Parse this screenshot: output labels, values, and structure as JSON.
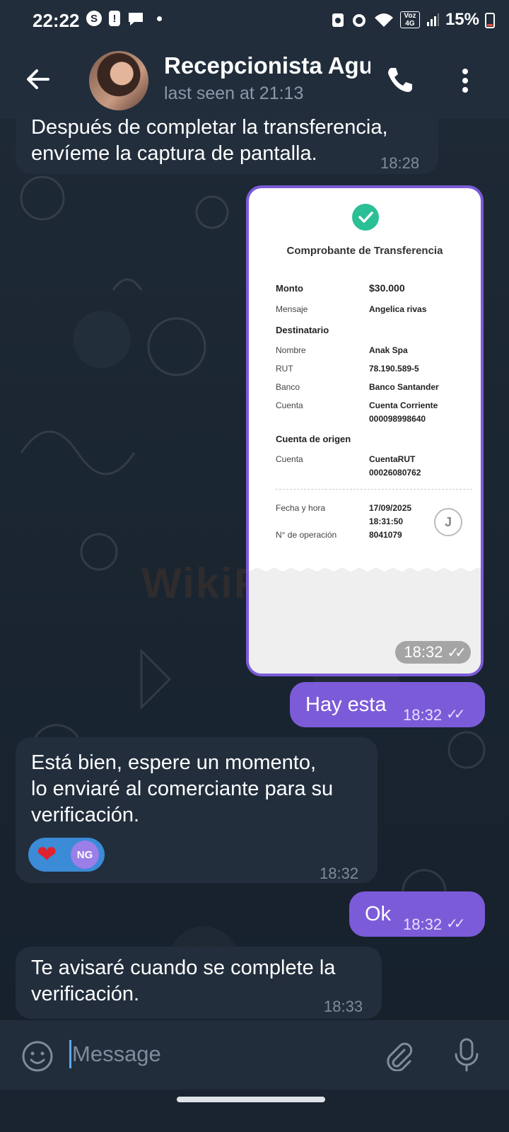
{
  "status_bar": {
    "time": "22:22",
    "signal_label": "Voz 4G",
    "battery": "15%",
    "icons": [
      "s-icon",
      "alert-icon",
      "chat-bubble-icon",
      "dot-icon",
      "recycle-icon",
      "alarm-icon",
      "wifi-icon",
      "signal-icon",
      "battery-icon"
    ]
  },
  "header": {
    "contact_name": "Recepcionista Agu",
    "last_seen": "last seen at 21:13",
    "icons": [
      "back-arrow-icon",
      "phone-icon",
      "more-vert-icon"
    ]
  },
  "messages": [
    {
      "direction": "in",
      "text_lines": [
        "Después de completar la transferencia,",
        "envíeme la captura de pantalla."
      ],
      "time": "18:28"
    },
    {
      "direction": "out",
      "type": "image",
      "time": "18:32"
    },
    {
      "direction": "out",
      "text": "Hay esta",
      "time": "18:32"
    },
    {
      "direction": "in",
      "text_lines": [
        "Está bien, espere un momento,",
        "lo enviaré al comerciante para su",
        "verificación."
      ],
      "time": "18:32",
      "reaction": {
        "emoji": "❤",
        "initials": "NG"
      }
    },
    {
      "direction": "out",
      "text": "Ok",
      "time": "18:32"
    },
    {
      "direction": "in",
      "text_lines": [
        "Te avisaré cuando se complete la",
        "verificación."
      ],
      "time": "18:33"
    }
  ],
  "receipt": {
    "title": "Comprobante de Transferencia",
    "monto_label": "Monto",
    "monto_value": "$30.000",
    "mensaje_label": "Mensaje",
    "mensaje_value": "Angelica rivas",
    "destinatario_heading": "Destinatario",
    "nombre_label": "Nombre",
    "nombre_value": "Anak Spa",
    "rut_label": "RUT",
    "rut_value": "78.190.589-5",
    "banco_label": "Banco",
    "banco_value": "Banco Santander",
    "cuenta_label": "Cuenta",
    "cuenta_value_1": "Cuenta Corriente",
    "cuenta_value_2": "000098998640",
    "origen_heading": "Cuenta de origen",
    "origen_cuenta_label": "Cuenta",
    "origen_cuenta_value_1": "CuentaRUT",
    "origen_cuenta_value_2": "00026080762",
    "fecha_label": "Fecha y hora",
    "fecha_value_1": "17/09/2025",
    "fecha_value_2": "18:31:50",
    "operacion_label": "N° de operación",
    "operacion_value": "8041079",
    "stamp_glyph": "J"
  },
  "input": {
    "placeholder": "Message"
  },
  "watermark": "WikiFX",
  "colors": {
    "outgoing_bubble": "#7c5bd9",
    "incoming_bubble": "#222e3c",
    "header": "#212d3b",
    "check": "#2bbf95"
  }
}
